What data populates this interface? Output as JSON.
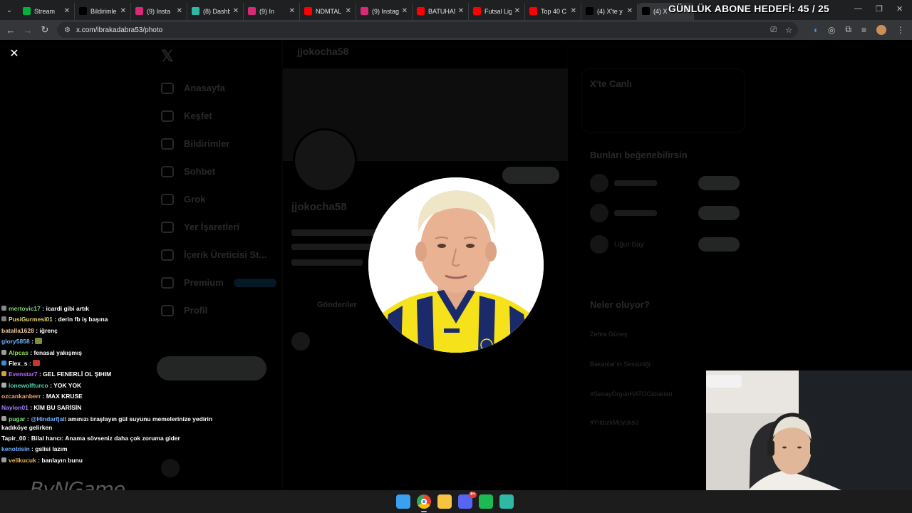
{
  "browser": {
    "tabs": [
      {
        "title": "Stream",
        "favicon": "stream-icon",
        "color": "#00b140"
      },
      {
        "title": "Bildirimle",
        "favicon": "x-icon",
        "color": "#000000"
      },
      {
        "title": "(9) Insta",
        "favicon": "instagram-icon",
        "color": "#d62976"
      },
      {
        "title": "(8) Dashb",
        "favicon": "dashboard-icon",
        "color": "#2fb9a5"
      },
      {
        "title": "(9) In",
        "favicon": "instagram-icon",
        "color": "#d62976"
      },
      {
        "title": "NDMTAL",
        "favicon": "youtube-icon",
        "color": "#ff0000"
      },
      {
        "title": "(9) Instag",
        "favicon": "instagram-icon",
        "color": "#d62976"
      },
      {
        "title": "BATUHAN",
        "favicon": "youtube-icon",
        "color": "#ff0000"
      },
      {
        "title": "Futsal Lig",
        "favicon": "youtube-icon",
        "color": "#ff0000"
      },
      {
        "title": "Top 40 C",
        "favicon": "youtube-icon",
        "color": "#ff0000"
      },
      {
        "title": "(4) X'te y",
        "favicon": "x-icon",
        "color": "#000000"
      },
      {
        "title": "(4) X",
        "favicon": "x-icon",
        "color": "#000000"
      }
    ],
    "url": "x.com/ibrakadabra53/photo"
  },
  "stream_overlay": {
    "goal_text": "GÜNLÜK ABONE HEDEFİ: 45 / 25",
    "watermark": "ByNGame"
  },
  "background_page": {
    "nav_items": [
      "Anasayfa",
      "Keşfet",
      "Bildirimler",
      "Sohbet",
      "Grok",
      "Yer İşaretleri",
      "İçerik Üreticisi St...",
      "Premium",
      "Profil"
    ],
    "profile_header": "jjokocha58",
    "profile_name": "jjokocha58",
    "tab_label": "Gönderiler",
    "right_titles": [
      "X'te Canlı",
      "Bunları beğenebilirsin",
      "Neler oluyor?"
    ],
    "suggestion_name": "Uğur Bay",
    "trends": [
      "Zehra Güneş",
      "Bakanlar'ın Sessizliği",
      "#SenayÖrgünHATOOldukları",
      "#YıldızlıMüyüksü"
    ]
  },
  "chat": [
    {
      "user": "mertovic17",
      "text": "icardi gibi artık",
      "color": "#7cd67c",
      "icon": "#888888"
    },
    {
      "user": "PusiGurmesi01",
      "text": "derin fb iş başına",
      "color": "#e8d37a",
      "icon": "#7c7c7c"
    },
    {
      "user": "batalla1628",
      "text": "iğrenç",
      "color": "#f2c59b",
      "icon": ""
    },
    {
      "user": "glory5858",
      "text": "",
      "color": "#6fb3ff",
      "icon": "",
      "emote": "#7d8f3a"
    },
    {
      "user": "Alpcas",
      "text": "fenasal yakışmış",
      "color": "#8ee05a",
      "icon": "#9b9b9b"
    },
    {
      "user": "Flex_s",
      "text": "",
      "color": "#ffffff",
      "icon": "#3a8bd6",
      "emote": "#c0392b"
    },
    {
      "user": "Evenstar7",
      "text": "GEL FENERLİ OL ŞIHIM",
      "color": "#b86bff",
      "icon": "#d6a03a"
    },
    {
      "user": "lonewolfturco",
      "text": "YOK YOK",
      "color": "#54d3a8",
      "icon": "#aaaaaa"
    },
    {
      "user": "ozcankanberr",
      "text": "MAX KRUSE",
      "color": "#f0a86a",
      "icon": ""
    },
    {
      "user": "Naylon01",
      "text": "KİM BU SARİSİN",
      "color": "#a77cff",
      "icon": ""
    },
    {
      "user": "pugar",
      "text": "@Hindarfjall amınızı tıraşlayın gül suyunu memelerinize yedirin kadıköye gelirken",
      "color": "#73e373",
      "icon": "#9b9b9b",
      "mention": "@Hindarfjall"
    },
    {
      "user": "Tapir_00",
      "text": "Bilal hancı: Anama sövseniz daha çok zoruma gider",
      "color": "#ffffff",
      "icon": ""
    },
    {
      "user": "kenobisin",
      "text": "gslisi lazım",
      "color": "#6fb3ff",
      "icon": ""
    },
    {
      "user": "velikucuk",
      "text": "banlayın bunu",
      "color": "#f0b35a",
      "icon": "#9b9b9b"
    }
  ],
  "taskbar": {
    "apps": [
      {
        "name": "windows-start-icon",
        "color": "#3aa0f0"
      },
      {
        "name": "chrome-icon",
        "color": "#e8e8e8"
      },
      {
        "name": "file-explorer-icon",
        "color": "#f5c542"
      },
      {
        "name": "discord-icon",
        "color": "#5865f2"
      },
      {
        "name": "spotify-icon",
        "color": "#1db954"
      },
      {
        "name": "app-icon",
        "color": "#2fb9a5"
      }
    ],
    "discord_badge": "9+"
  }
}
